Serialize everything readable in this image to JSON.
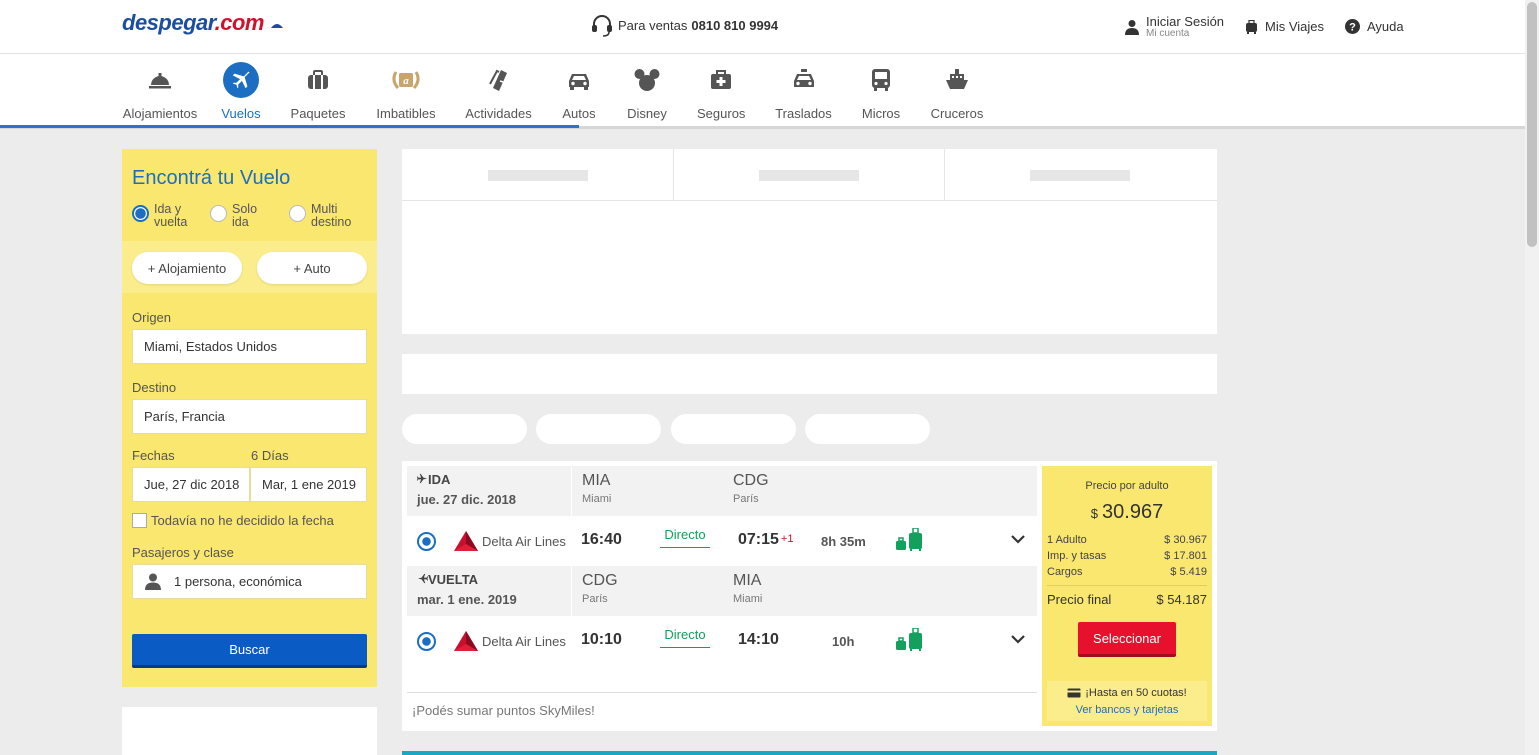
{
  "header": {
    "logo_main": "despegar",
    "logo_com": ".com",
    "sales_label": "Para ventas",
    "sales_phone": "0810 810 9994",
    "login_label": "Iniciar Sesión",
    "login_sub": "Mi cuenta",
    "trips_label": "Mis Viajes",
    "help_label": "Ayuda"
  },
  "nav": {
    "items": [
      {
        "label": "Alojamientos",
        "icon": "hotel-bell-icon"
      },
      {
        "label": "Vuelos",
        "icon": "airplane-icon"
      },
      {
        "label": "Paquetes",
        "icon": "suitcase-icon"
      },
      {
        "label": "Imbatibles",
        "icon": "laurel-badge-icon"
      },
      {
        "label": "Actividades",
        "icon": "tickets-icon"
      },
      {
        "label": "Autos",
        "icon": "car-icon"
      },
      {
        "label": "Disney",
        "icon": "mickey-icon"
      },
      {
        "label": "Seguros",
        "icon": "medical-kit-icon"
      },
      {
        "label": "Traslados",
        "icon": "taxi-icon"
      },
      {
        "label": "Micros",
        "icon": "bus-icon"
      },
      {
        "label": "Cruceros",
        "icon": "ship-icon"
      }
    ],
    "active": "Vuelos"
  },
  "search": {
    "title": "Encontrá tu Vuelo",
    "trip_types": [
      "Ida y vuelta",
      "Solo ida",
      "Multi destino"
    ],
    "add_hotel": "+ Alojamiento",
    "add_car": "+ Auto",
    "origin_label": "Origen",
    "origin_value": "Miami, Estados Unidos",
    "dest_label": "Destino",
    "dest_value": "París, Francia",
    "dates_label": "Fechas",
    "days_label": "6 Días",
    "date_from": "Jue, 27 dic 2018",
    "date_to": "Mar, 1 ene 2019",
    "undecided": "Todavía no he decidido la fecha",
    "pax_label": "Pasajeros y clase",
    "pax_value": "1 persona, económica",
    "submit": "Buscar"
  },
  "result": {
    "outbound": {
      "label": "IDA",
      "date": "jue. 27 dic. 2018",
      "from_code": "MIA",
      "from_city": "Miami",
      "to_code": "CDG",
      "to_city": "París",
      "airline": "Delta Air Lines",
      "dep": "16:40",
      "type": "Directo",
      "arr": "07:15",
      "plus": "+1",
      "duration": "8h 35m"
    },
    "inbound": {
      "label": "VUELTA",
      "date": "mar. 1 ene. 2019",
      "from_code": "CDG",
      "from_city": "París",
      "to_code": "MIA",
      "to_city": "Miami",
      "airline": "Delta Air Lines",
      "dep": "10:10",
      "type": "Directo",
      "arr": "14:10",
      "duration": "10h"
    },
    "skymiles": "¡Podés sumar puntos SkyMiles!",
    "price": {
      "per_adult": "Precio por adulto",
      "currency": "$",
      "amount": "30.967",
      "rows": [
        {
          "label": "1 Adulto",
          "value": "$  30.967"
        },
        {
          "label": "Imp. y tasas",
          "value": "$  17.801"
        },
        {
          "label": "Cargos",
          "value": "$  5.419"
        }
      ],
      "final_label": "Precio final",
      "final_value": "$  54.187",
      "select": "Seleccionar",
      "installments": "¡Hasta en 50 cuotas!",
      "banks_link": "Ver bancos y tarjetas"
    }
  },
  "colors": {
    "brand_blue": "#1b6ec2",
    "panel_yellow": "#fae76f",
    "cta_red": "#e8112d",
    "direct_green": "#12a05c"
  }
}
